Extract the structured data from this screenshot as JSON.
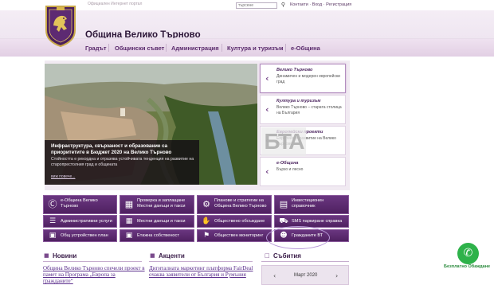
{
  "topbar": {
    "left_text": "Официален Интернет портал",
    "search_placeholder": "търсене",
    "links": "Контакти · Вход · Регистрация"
  },
  "header": {
    "title": "Община Велико Търново"
  },
  "nav": [
    {
      "label": "Градът"
    },
    {
      "label": "Общински съвет"
    },
    {
      "label": "Администрация"
    },
    {
      "label": "Култура и туризъм"
    },
    {
      "label": "е-Община"
    }
  ],
  "hero": {
    "title": "Инфраструктура, свързаност и образование са приоритетите в Бюджет 2020 на Велико Търново",
    "text": "Стойността е рекордна и отразява устойчивата тенденция на развитие на старопрестолния град и общината",
    "more": "виж повече..."
  },
  "side_tabs": [
    {
      "title": "Велико Търново",
      "sub": "Динамичен и модерен европейски град"
    },
    {
      "title": "Култура и туризъм",
      "sub": "Велико Търново – старата столица на България"
    },
    {
      "title": "Европейски проекти",
      "sub": "Европейско развитие на Велико Търново"
    },
    {
      "title": "е-Община",
      "sub": "Бързо и лесно"
    }
  ],
  "watermark": "БТА",
  "tiles_row1": [
    {
      "label": "е-Община Велико Търново"
    },
    {
      "label": "Проверка и заплащане Местни данъци и такси"
    },
    {
      "label": "Планове и стратегии на Община Велико Търново"
    },
    {
      "label": "Инвестиционен справочник"
    }
  ],
  "tiles_row2": [
    {
      "label": "Административни услуги"
    },
    {
      "label": "Местни данъци и такси"
    },
    {
      "label": "Обществено обсъждане"
    },
    {
      "label": "SMS паркиране справка"
    }
  ],
  "tiles_row3": [
    {
      "label": "Общ устройствен план"
    },
    {
      "label": "Етажна собственост"
    },
    {
      "label": "Обществен мониторинг"
    },
    {
      "label": "Гражданите ВТ"
    }
  ],
  "sections": {
    "news": {
      "title": "Новини",
      "item": "Община Велико Търново спечели проект в памет на Програма „Европа за гражданите“"
    },
    "accents": {
      "title": "Акценти",
      "item": "Дигиталната маркетинг платформа FairDeal очаква заявители от България и Румъния"
    },
    "events": {
      "title": "Събития",
      "month": "Март 2020"
    }
  },
  "phone": {
    "label": "Безплатно Обаждане"
  }
}
